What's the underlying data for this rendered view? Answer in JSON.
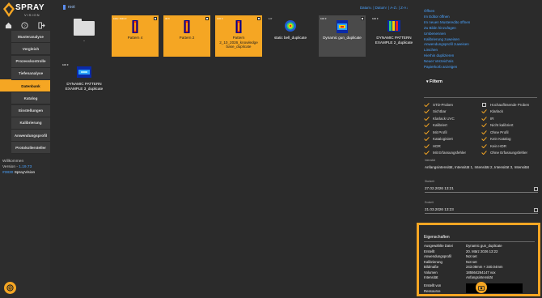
{
  "brand": {
    "name": "SPRAY",
    "sub": "VISION"
  },
  "nav": [
    {
      "label": "Musteranalyse"
    },
    {
      "label": "Vergleich"
    },
    {
      "label": "Prozesskontrolle"
    },
    {
      "label": "Tiefenanalyse"
    },
    {
      "label": "Datenbank",
      "active": true
    },
    {
      "label": "Katalog"
    },
    {
      "label": "Einstellungen"
    },
    {
      "label": "Kalibrierung"
    },
    {
      "label": "Anwendungsprofil"
    },
    {
      "label": "Protokollersteller"
    }
  ],
  "welcome": {
    "line1": "Willkommen",
    "version_prefix": "Version - ",
    "version": "1.19.73",
    "tag": "#3830",
    "app": "SprayVision"
  },
  "breadcrumb": {
    "root": "root"
  },
  "sort": {
    "a": "Datum↓",
    "b": "Datum↑",
    "c": "A-Z↓",
    "d": "Z-A↓"
  },
  "tiles": [
    {
      "label": ".."
    },
    {
      "label": "Pattern 4",
      "count": "100x 1549 fr"
    },
    {
      "label": "Pattern 2",
      "count": "30 fr"
    },
    {
      "label": "Pattern 2_10_2026_knowledge base_duplicate",
      "count": "100 fr"
    },
    {
      "label": "static bell_duplicate",
      "count": "1 fr"
    },
    {
      "label": "Dynamic gun_duplicate",
      "count": "100 fr"
    },
    {
      "label": "DYNAMIC PATTERN EXAMPLE 2_duplicate",
      "count": "100 fr"
    },
    {
      "label": "DYNAMIC PATTERN EXAMPLE 3_duplicate",
      "count": "100 fr"
    }
  ],
  "actions": [
    "Öffnen",
    "Im Editor öffnen",
    "Im neuen Musteredito öffnen",
    "Zu Bildn hinzufügen",
    "Umbenennen",
    "Kalibrierung zuweisen",
    "Anwendungsprofil zuweisen",
    "Löschen",
    "Hierhin duplizieren",
    "Neuer Verzeichnis",
    "Papierkorb anzeigen"
  ],
  "filter": {
    "title": "Filtern",
    "rows": [
      [
        "STD-Proben",
        "Hochauflösende Proben"
      ],
      [
        "Sichtbar",
        "Klarlack"
      ],
      [
        "Klarlack UVC",
        "IR"
      ],
      [
        "Kalibriert",
        "Nicht kalibriert"
      ],
      [
        "Mit Profil",
        "Ohne Profil"
      ],
      [
        "Katalogisiert",
        "Kein Katalog"
      ],
      [
        "HDR",
        "Kein HDR"
      ],
      [
        "Mit Erfassungsfehler",
        "Ohne Erfassungsfehler"
      ]
    ],
    "checked": [
      [
        true,
        false
      ],
      [
        true,
        true
      ],
      [
        true,
        true
      ],
      [
        true,
        true
      ],
      [
        true,
        true
      ],
      [
        true,
        true
      ],
      [
        true,
        true
      ],
      [
        true,
        true
      ]
    ],
    "intensity_label": "Intensität",
    "intensity_value": "Anfangsintensität, Intensität 1, Intensität 2, Intensität 3, Intensität",
    "start_label": "Startzeit",
    "start_value": "27.02.2026 13:21",
    "end_label": "Endzeit",
    "end_value": "21.03.2026 13:23"
  },
  "properties": {
    "title": "Eigenschaften",
    "rows": [
      {
        "k": "Ausgewählte Datei",
        "v": "Dynamic gun_duplicate"
      },
      {
        "k": "Erstellt",
        "v": "20. März 2026 13:22"
      },
      {
        "k": "Anwendungsprofil",
        "v": "Not set"
      },
      {
        "k": "Kalibrierung",
        "v": "Not set"
      },
      {
        "k": "Bildmaße",
        "v": "243.08mm × 340.04mm"
      },
      {
        "k": "Volumen",
        "v": "185564264147 vox"
      },
      {
        "k": "Intensität",
        "v": "Anfangsintensität"
      },
      {
        "k": "Erstellt von",
        "v": ""
      },
      {
        "k": "Ressource",
        "v": ""
      }
    ]
  },
  "colors": {
    "accent": "#f5a623",
    "link": "#4aa3ff"
  }
}
